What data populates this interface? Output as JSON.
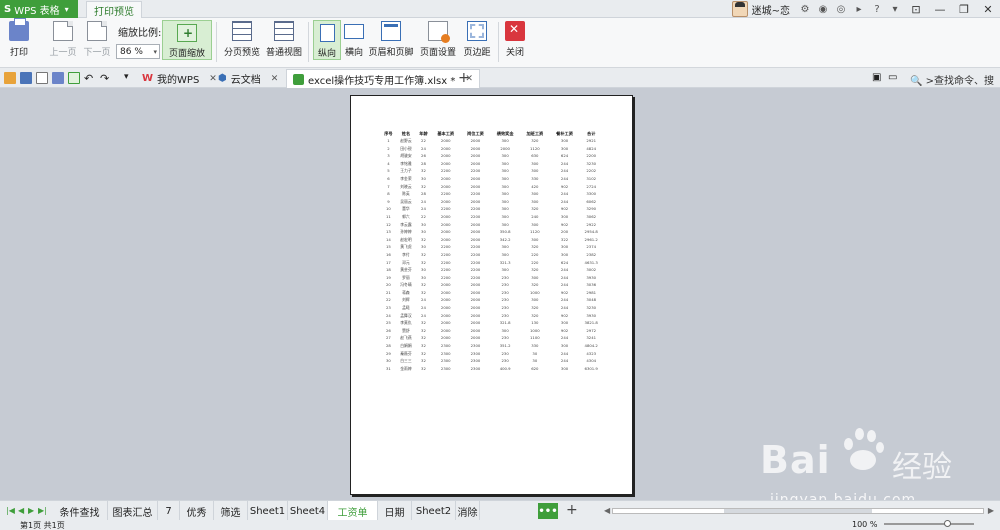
{
  "titlebar": {
    "app_name": "WPS 表格",
    "ribbon_tab": "打印预览",
    "user": "迷城~恋",
    "window_buttons": [
      "minimize",
      "restore",
      "close"
    ]
  },
  "ribbon": {
    "print": "打印",
    "prev_page": "上一页",
    "next_page": "下一页",
    "zoom_label": "缩放比例:",
    "zoom_value": "86 %",
    "page_zoom": "页面缩放",
    "page_break_preview": "分页预览",
    "normal_view": "普通视图",
    "portrait": "纵向",
    "landscape": "横向",
    "header_footer": "页眉和页脚",
    "page_setup": "页面设置",
    "margins": "页边距",
    "close": "关闭"
  },
  "doc_tabs": {
    "tab1": "我的WPS",
    "tab2": "云文档",
    "tab3": "excel操作技巧专用工作簿.xlsx *",
    "search": "查找命令、搜索..."
  },
  "sheet": {
    "headers": [
      "序号",
      "姓名",
      "年龄",
      "基本工资",
      "岗位工资",
      "绩效奖金",
      "加班工资",
      "餐补工资",
      "合计"
    ],
    "rows": [
      [
        "1",
        "赵野云",
        "22",
        "2000",
        "2000",
        "300",
        "320",
        "300",
        "2921"
      ],
      [
        "2",
        "田小锐",
        "24",
        "2000",
        "2000",
        "2000",
        "1120",
        "300",
        "4824"
      ],
      [
        "3",
        "胡骏安",
        "26",
        "2000",
        "2000",
        "300",
        "630",
        "624",
        "2200"
      ],
      [
        "4",
        "李铭雅",
        "28",
        "2000",
        "2000",
        "300",
        "300",
        "244",
        "3230"
      ],
      [
        "5",
        "王力子",
        "32",
        "2200",
        "2200",
        "300",
        "300",
        "244",
        "2202"
      ],
      [
        "6",
        "李金荣",
        "30",
        "2000",
        "2000",
        "300",
        "330",
        "244",
        "3102"
      ],
      [
        "7",
        "刘晓云",
        "32",
        "2000",
        "2000",
        "300",
        "420",
        "902",
        "2724"
      ],
      [
        "8",
        "陈英",
        "28",
        "2200",
        "2200",
        "300",
        "300",
        "244",
        "3300"
      ],
      [
        "9",
        "吴丽云",
        "24",
        "2000",
        "2000",
        "300",
        "300",
        "244",
        "6062"
      ],
      [
        "10",
        "董华",
        "24",
        "2200",
        "2200",
        "300",
        "320",
        "902",
        "3290"
      ],
      [
        "11",
        "郭六",
        "22",
        "2000",
        "2200",
        "300",
        "240",
        "300",
        "3062"
      ],
      [
        "12",
        "李云露",
        "30",
        "2000",
        "2000",
        "300",
        "300",
        "902",
        "2922"
      ],
      [
        "13",
        "孙婷婷",
        "30",
        "2000",
        "2000",
        "350.8",
        "1120",
        "200",
        "2954.8"
      ],
      [
        "14",
        "赵宏明",
        "32",
        "2000",
        "2000",
        "342.2",
        "300",
        "322",
        "2961.2"
      ],
      [
        "15",
        "黄飞虎",
        "30",
        "2200",
        "2200",
        "300",
        "320",
        "300",
        "2374"
      ],
      [
        "16",
        "李付",
        "32",
        "2200",
        "2200",
        "300",
        "220",
        "300",
        "2382"
      ],
      [
        "17",
        "邓元",
        "32",
        "2200",
        "2200",
        "321.3",
        "220",
        "624",
        "4631.3"
      ],
      [
        "18",
        "黄芸芬",
        "30",
        "2200",
        "2200",
        "300",
        "320",
        "244",
        "3002"
      ],
      [
        "19",
        "罗丽",
        "30",
        "2200",
        "2200",
        "230",
        "300",
        "244",
        "3930"
      ],
      [
        "20",
        "冯冬晴",
        "32",
        "2000",
        "2000",
        "230",
        "320",
        "244",
        "3036"
      ],
      [
        "21",
        "蒋森",
        "32",
        "2000",
        "2000",
        "230",
        "1000",
        "902",
        "2981"
      ],
      [
        "22",
        "刘辉",
        "24",
        "2000",
        "2000",
        "230",
        "300",
        "244",
        "3048"
      ],
      [
        "23",
        "孟曦",
        "24",
        "2000",
        "2000",
        "230",
        "320",
        "244",
        "3230"
      ],
      [
        "24",
        "孟舞汉",
        "24",
        "2000",
        "2000",
        "230",
        "320",
        "902",
        "3930"
      ],
      [
        "25",
        "李莫仇",
        "32",
        "2000",
        "2000",
        "321.8",
        "130",
        "300",
        "3821.8"
      ],
      [
        "26",
        "赞舒",
        "32",
        "2000",
        "2000",
        "300",
        "1000",
        "902",
        "2972"
      ],
      [
        "27",
        "赵飞燕",
        "32",
        "2000",
        "2000",
        "230",
        "1100",
        "244",
        "3241"
      ],
      [
        "28",
        "白娟娟",
        "32",
        "2300",
        "2300",
        "351.2",
        "330",
        "300",
        "4804.2"
      ],
      [
        "29",
        "秦薇芬",
        "32",
        "2300",
        "2300",
        "230",
        "30",
        "244",
        "4323"
      ],
      [
        "30",
        "白三三",
        "32",
        "2300",
        "2300",
        "230",
        "30",
        "244",
        "4304"
      ],
      [
        "31",
        "金雨婷",
        "32",
        "2300",
        "2300",
        "400.9",
        "620",
        "300",
        "6301.9"
      ]
    ]
  },
  "sheet_tabs": {
    "tabs": [
      "条件查找",
      "图表汇总",
      "7",
      "优秀",
      "筛选",
      "Sheet1",
      "Sheet4",
      "工资单",
      "日期",
      "Sheet2",
      "消除"
    ],
    "active": "工资单",
    "more": "•••"
  },
  "status": {
    "page_info": "第1页 共1页",
    "zoom": "100 %"
  },
  "watermark": {
    "brand": "Bai",
    "cn": "经验",
    "url": "jingyan.baidu.com"
  }
}
